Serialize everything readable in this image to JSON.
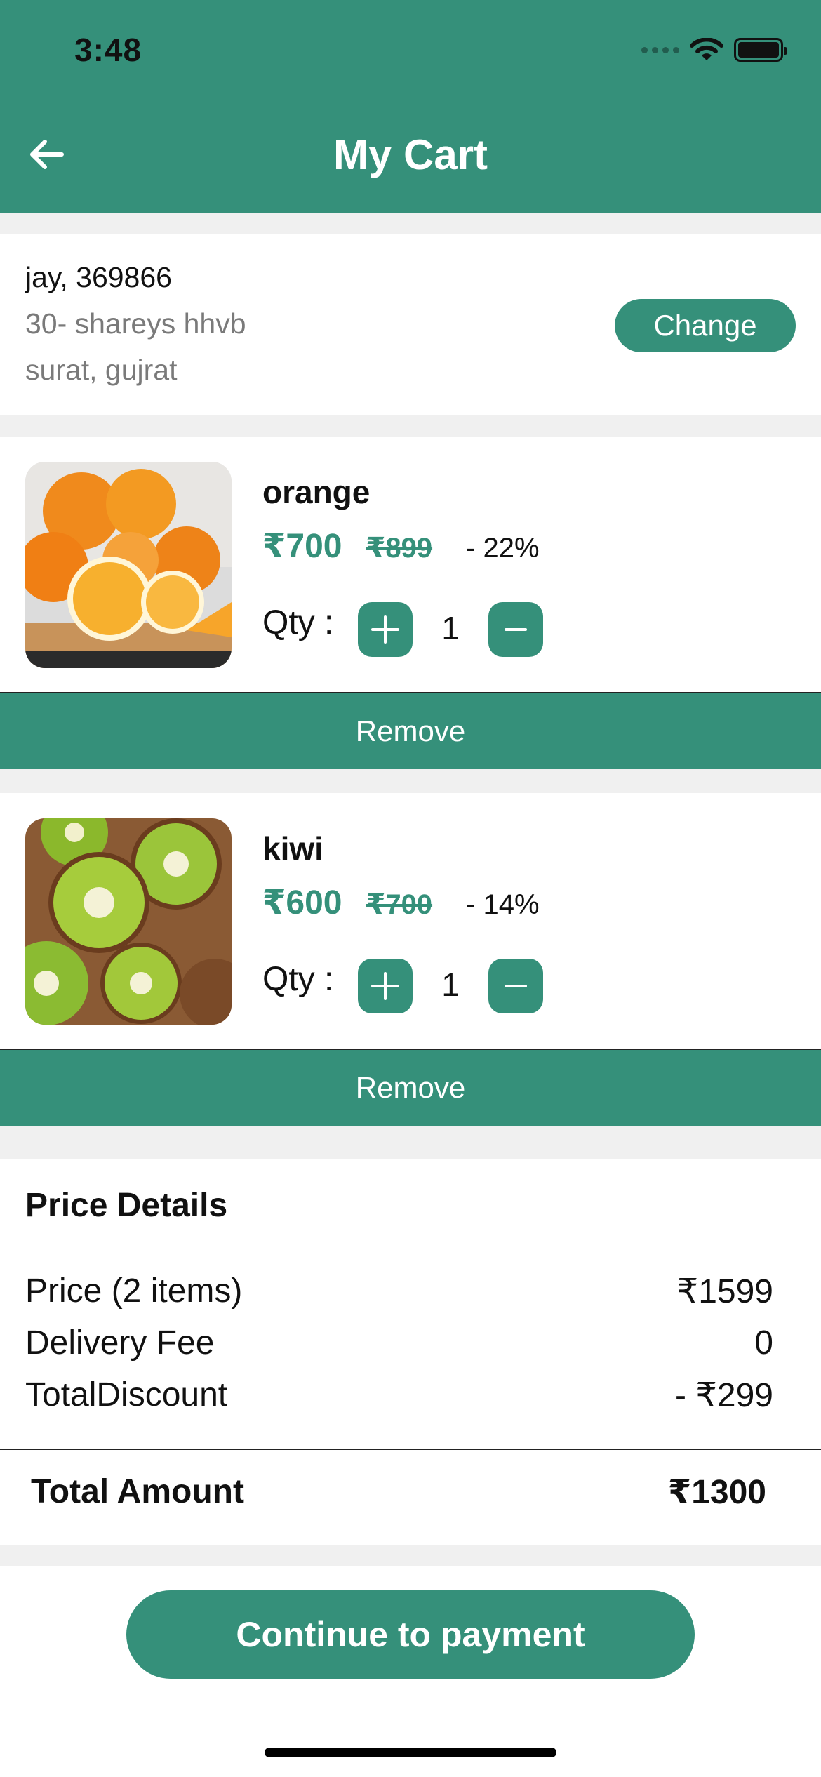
{
  "status_bar": {
    "time": "3:48"
  },
  "header": {
    "title": "My Cart"
  },
  "address": {
    "name_line": "jay, 369866",
    "line2": "30- shareys hhvb",
    "line3": "surat, gujrat",
    "change_label": "Change"
  },
  "items": [
    {
      "name": "orange",
      "price": "₹700",
      "mrp": "₹899",
      "discount": "- 22%",
      "qty_label": "Qty :",
      "qty": "1",
      "remove_label": "Remove"
    },
    {
      "name": "kiwi",
      "price": "₹600",
      "mrp": "₹700",
      "discount": "- 14%",
      "qty_label": "Qty :",
      "qty": "1",
      "remove_label": "Remove"
    }
  ],
  "price_details": {
    "title": "Price Details",
    "rows": [
      {
        "label": "Price (2 items)",
        "value": "₹1599"
      },
      {
        "label": "Delivery Fee",
        "value": "0"
      },
      {
        "label": "TotalDiscount",
        "value": "- ₹299"
      }
    ],
    "total_label": "Total Amount",
    "total_value": "₹1300"
  },
  "footer": {
    "pay_label": "Continue to payment"
  },
  "colors": {
    "accent": "#35907a",
    "background": "#f0f0f0"
  },
  "icons": [
    "back-arrow-icon",
    "wifi-icon",
    "battery-icon",
    "plus-icon",
    "minus-icon"
  ]
}
